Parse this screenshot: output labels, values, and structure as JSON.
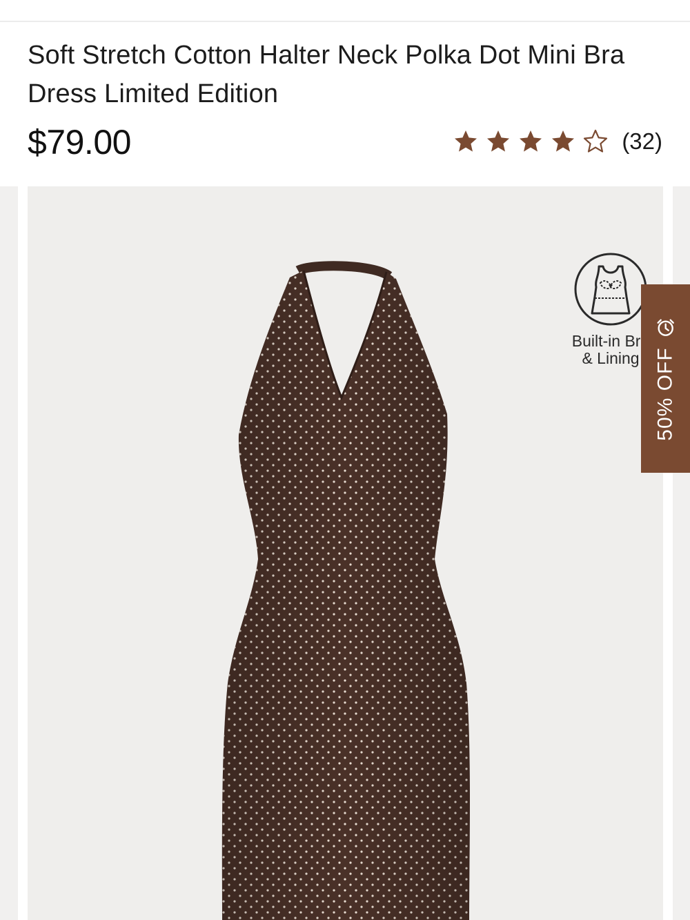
{
  "product": {
    "title": "Soft Stretch Cotton Halter Neck Polka Dot Mini Bra Dress Limited Edition",
    "price": "$79.00",
    "rating": {
      "value": 4,
      "max": 5,
      "review_count": "(32)"
    }
  },
  "gallery": {
    "image_icon": "halter-dress-product-photo",
    "feature_badge": {
      "icon": "bra-lining-icon",
      "label": "Built-in Bra\n& Lining"
    },
    "sale_tab": {
      "label": "50% OFF",
      "icon": "alarm-clock-icon"
    }
  },
  "colors": {
    "star": "#7a4a31",
    "sale_tab_bg": "#7a4a31",
    "dress": "#4a3128",
    "gallery_bg": "#efeeec"
  }
}
